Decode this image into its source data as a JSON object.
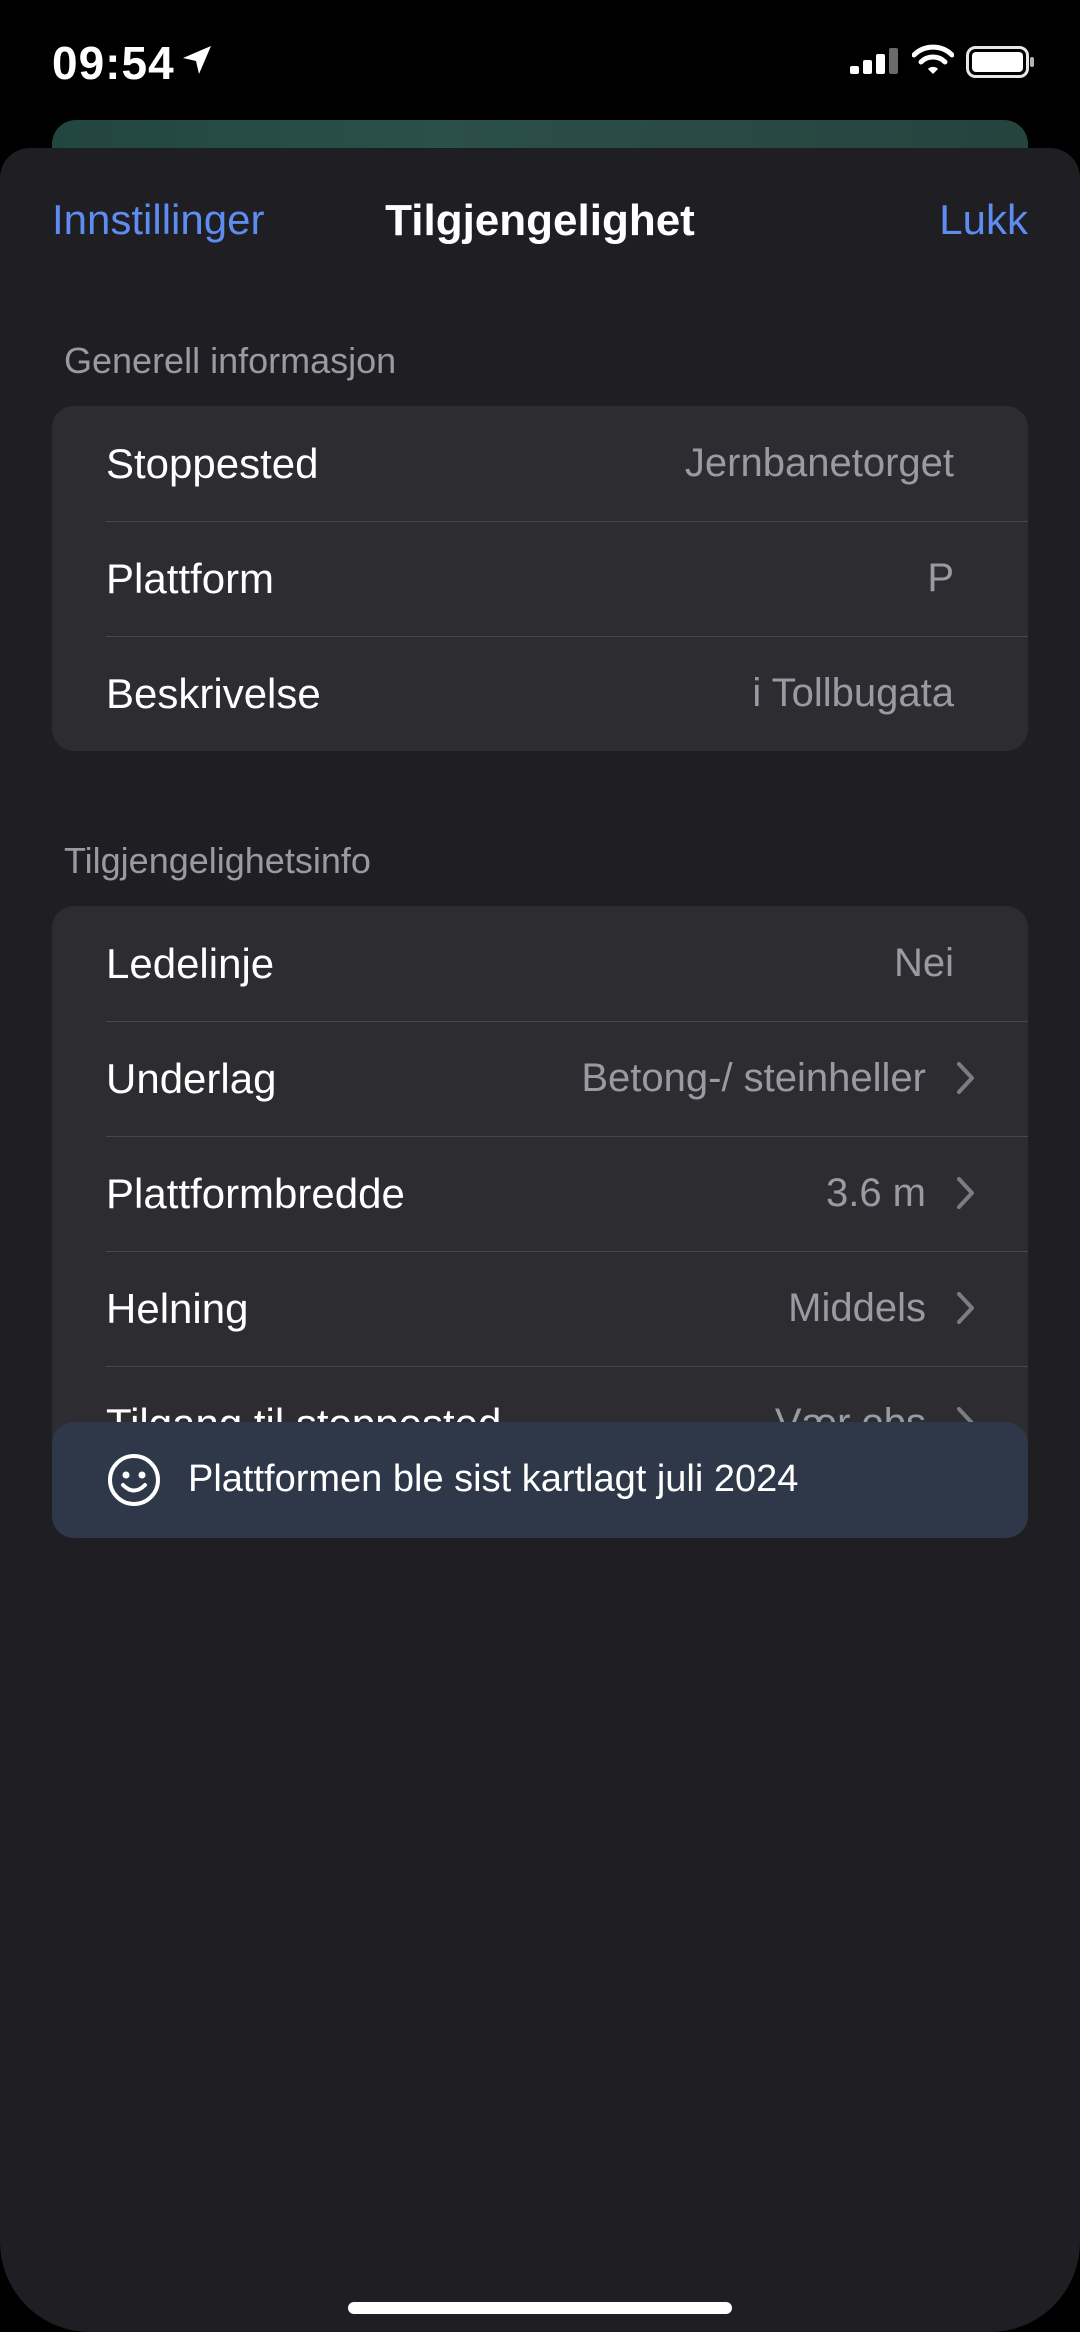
{
  "status_bar": {
    "time": "09:54"
  },
  "nav": {
    "back_label": "Innstillinger",
    "title": "Tilgjengelighet",
    "close_label": "Lukk"
  },
  "general": {
    "header": "Generell informasjon",
    "rows": [
      {
        "label": "Stoppested",
        "value": "Jernbanetorget"
      },
      {
        "label": "Plattform",
        "value": "P"
      },
      {
        "label": "Beskrivelse",
        "value": "i Tollbugata"
      }
    ]
  },
  "accessibility": {
    "header": "Tilgjengelighetsinfo",
    "rows": [
      {
        "label": "Ledelinje",
        "value": "Nei"
      },
      {
        "label": "Underlag",
        "value": "Betong-/ steinheller"
      },
      {
        "label": "Plattformbredde",
        "value": "3.6 m"
      },
      {
        "label": "Helning",
        "value": "Middels"
      },
      {
        "label": "Tilgang til stoppested",
        "value": "Vær obs"
      }
    ]
  },
  "banner": {
    "icon": "smile-icon",
    "text": "Plattformen ble sist kartlagt juli 2024"
  },
  "colors": {
    "accent": "#5e8cf0",
    "sheet_bg": "#1e1e23",
    "group_bg": "#2c2c31",
    "banner_bg": "#2e3849"
  }
}
